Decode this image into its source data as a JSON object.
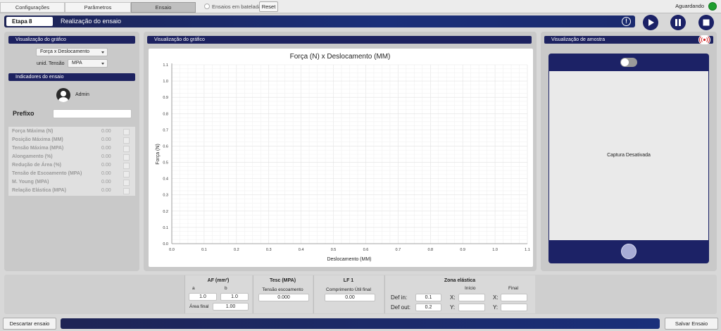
{
  "tabs": [
    {
      "label": "Configurações"
    },
    {
      "label": "Parâmetros"
    },
    {
      "label": "Ensaio"
    }
  ],
  "batch_label": "Ensaios em batelada",
  "reset_label": "Reset",
  "status_text": "Aguardando",
  "stage": {
    "badge": "Etapa 8",
    "title": "Realização do ensaio"
  },
  "left": {
    "graph_header": "Visualização do gráfico",
    "graph_select": "Força x Deslocamento",
    "unit_label": "unid. Tensão",
    "unit_value": "MPA",
    "indicators_header": "Indicadores do ensaio",
    "user": "Admin",
    "prefix_label": "Prefixo",
    "prefix_value": "",
    "indicators": [
      {
        "name": "Força Máxima (N)",
        "value": "0.00"
      },
      {
        "name": "Posição Máxima (MM)",
        "value": "0.00"
      },
      {
        "name": "Tensão Máxima (MPA)",
        "value": "0.00"
      },
      {
        "name": "Alongamento (%)",
        "value": "0.00"
      },
      {
        "name": "Redução de Área (%)",
        "value": "0.00"
      },
      {
        "name": "Tensão de Escoamento (MPA)",
        "value": "0.00"
      },
      {
        "name": "M. Young (MPA)",
        "value": "0.00"
      },
      {
        "name": "Relação Elástica (MPA)",
        "value": "0.00"
      }
    ]
  },
  "center": {
    "header": "Visualização do gráfico"
  },
  "right": {
    "header": "Visualização de amostra",
    "capture_text": "Captura Desativada"
  },
  "chart_data": {
    "type": "line",
    "title": "Força (N) x Deslocamento (MM)",
    "xlabel": "Deslocamento (MM)",
    "ylabel": "Força (N)",
    "xlim": [
      0,
      1.1
    ],
    "ylim": [
      0,
      1.1
    ],
    "xticks": [
      "0.0",
      "0.1",
      "0.2",
      "0.3",
      "0.4",
      "0.5",
      "0.6",
      "0.7",
      "0.8",
      "0.9",
      "1.0",
      "1.1"
    ],
    "yticks": [
      "0.0",
      "0.1",
      "0.2",
      "0.3",
      "0.4",
      "0.5",
      "0.6",
      "0.7",
      "0.8",
      "0.9",
      "1.0",
      "1.1"
    ],
    "grid": true,
    "series": []
  },
  "bottom": {
    "af": {
      "title": "AF (mm²)",
      "a_label": "a",
      "b_label": "b",
      "a_value": "1.0",
      "b_value": "1.0",
      "area_label": "Área final",
      "area_value": "1.00"
    },
    "tesc": {
      "title": "Tesc (MPA)",
      "sub": "Tensão escoamento",
      "value": "0.000"
    },
    "lf": {
      "title": "LF 1",
      "sub": "Comprimento Útil final",
      "value": "0.00"
    },
    "zona": {
      "title": "Zona elástica",
      "inicio": "Início",
      "final": "Final",
      "def_in_label": "Def in:",
      "def_in_value": "0.1",
      "def_out_label": "Def out:",
      "def_out_value": "0.2",
      "x_label": "X:",
      "y_label": "Y:",
      "x_value": "",
      "y_value": "",
      "x2_value": "",
      "y2_value": ""
    }
  },
  "footer": {
    "discard": "Descartar ensaio",
    "save": "Salvar Ensaio"
  }
}
